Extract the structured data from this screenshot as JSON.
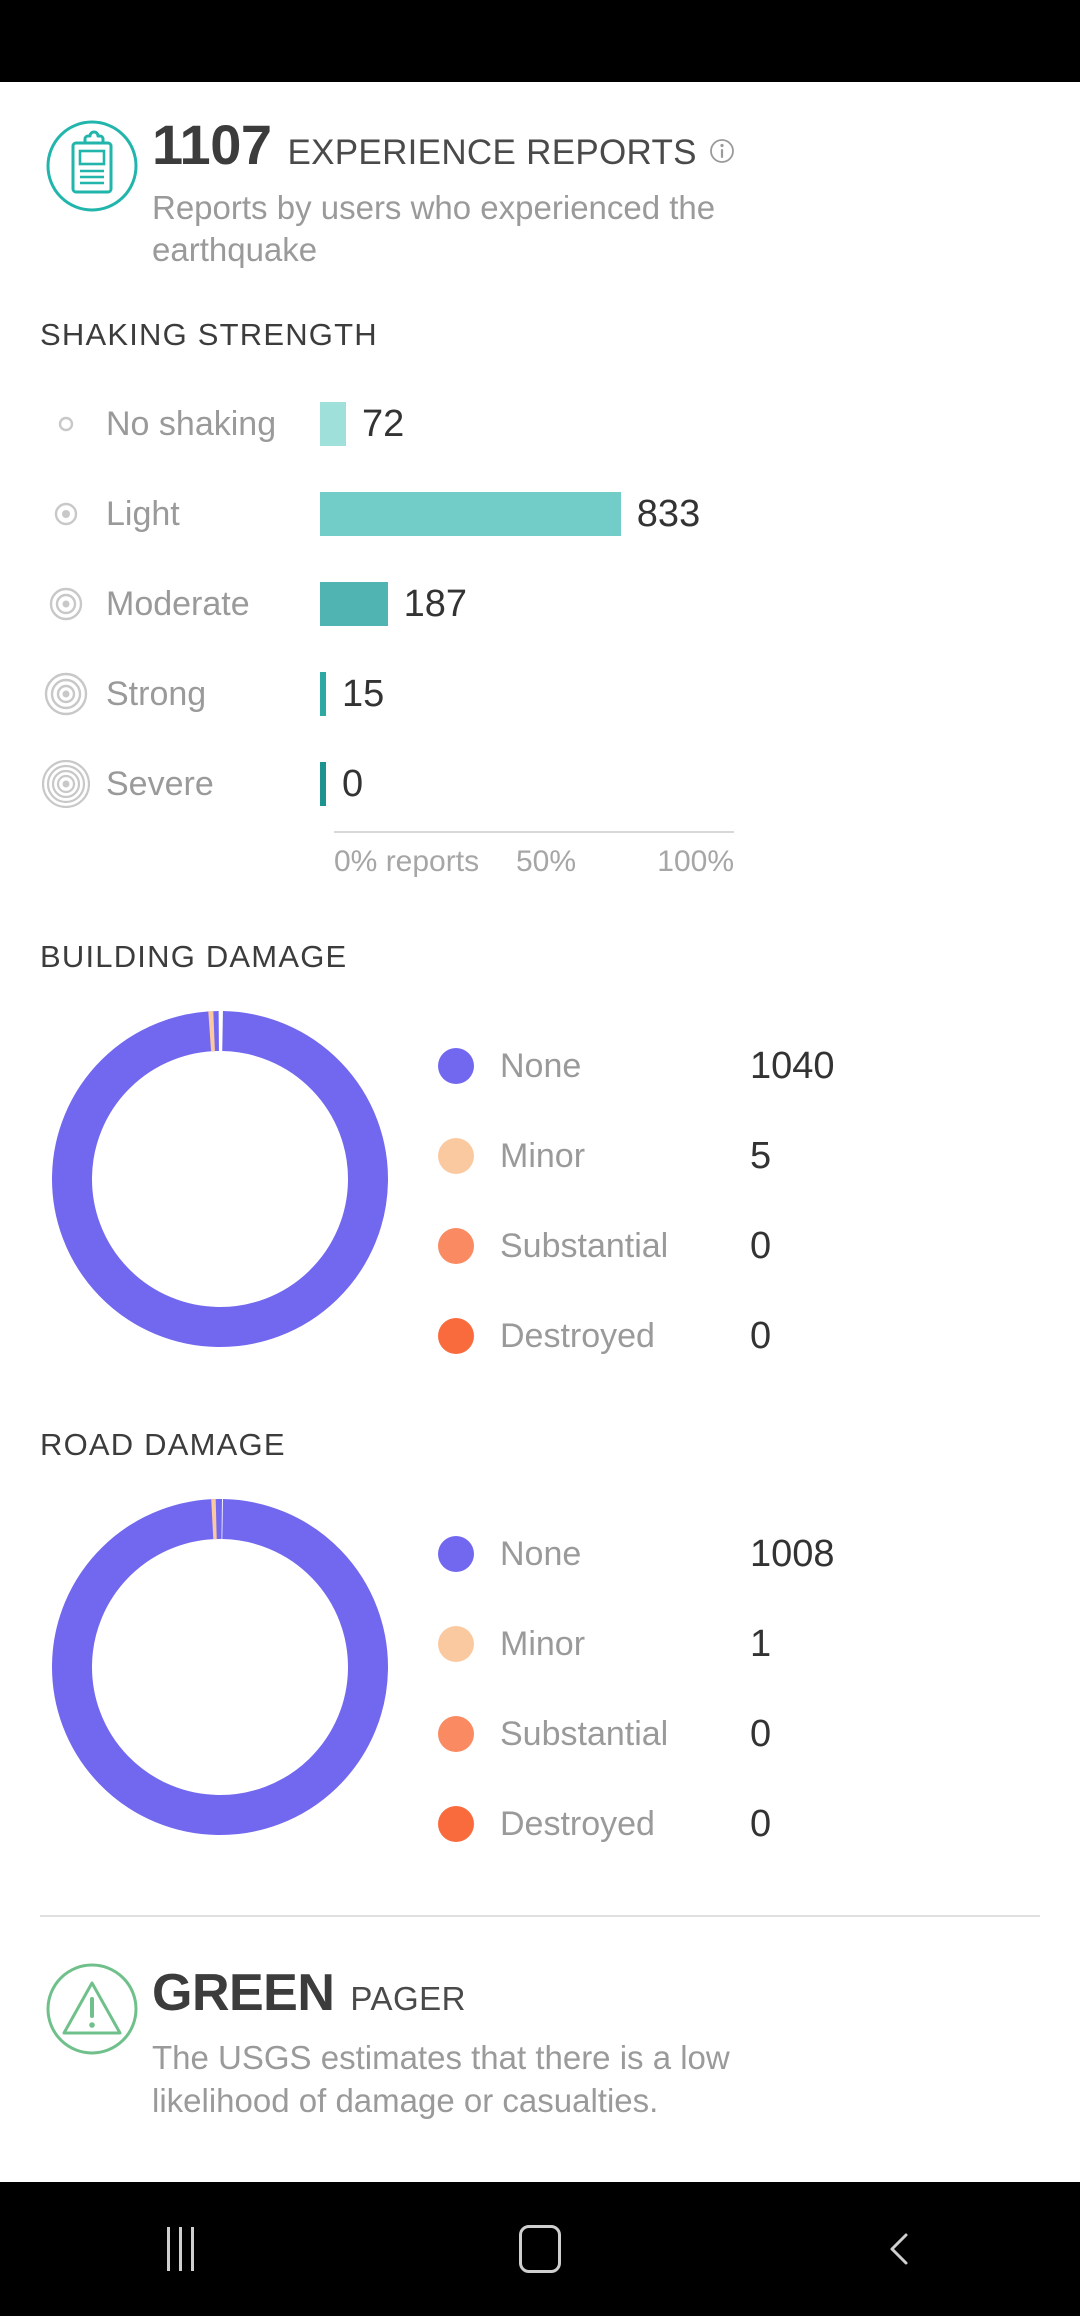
{
  "status_bar": {
    "visible": true
  },
  "header": {
    "icon": "clipboard-report-icon",
    "count": "1107",
    "label": "EXPERIENCE REPORTS",
    "info_icon": "info-circle-icon",
    "description": "Reports by users who experienced the earthquake"
  },
  "shaking": {
    "title": "SHAKING STRENGTH",
    "axis": {
      "start": "0% reports",
      "mid": "50%",
      "end": "100%"
    },
    "rows": [
      {
        "icon": "rings-1-icon",
        "label": "No shaking",
        "value": "72",
        "pct": 6.5,
        "color": "#9fe0da"
      },
      {
        "icon": "rings-2-icon",
        "label": "Light",
        "value": "833",
        "pct": 75.2,
        "color": "#72cdc9"
      },
      {
        "icon": "rings-3-icon",
        "label": "Moderate",
        "value": "187",
        "pct": 16.9,
        "color": "#50b5b2"
      },
      {
        "icon": "rings-4-icon",
        "label": "Strong",
        "value": "15",
        "pct": 1.4,
        "color": "#2da8a2"
      },
      {
        "icon": "rings-5-icon",
        "label": "Severe",
        "value": "0",
        "pct": 0.0,
        "color": "#1d938f"
      }
    ]
  },
  "building_damage": {
    "title": "BUILDING DAMAGE",
    "legend": [
      {
        "label": "None",
        "value": "1040",
        "color": "#7268f0"
      },
      {
        "label": "Minor",
        "value": "5",
        "color": "#fbc9a0"
      },
      {
        "label": "Substantial",
        "value": "0",
        "color": "#f98a62"
      },
      {
        "label": "Destroyed",
        "value": "0",
        "color": "#f96a3c"
      }
    ]
  },
  "road_damage": {
    "title": "ROAD DAMAGE",
    "legend": [
      {
        "label": "None",
        "value": "1008",
        "color": "#7268f0"
      },
      {
        "label": "Minor",
        "value": "1",
        "color": "#fbc9a0"
      },
      {
        "label": "Substantial",
        "value": "0",
        "color": "#f98a62"
      },
      {
        "label": "Destroyed",
        "value": "0",
        "color": "#f96a3c"
      }
    ]
  },
  "pager": {
    "icon": "warning-triangle-icon",
    "level": "GREEN",
    "word": "PAGER",
    "description": "The USGS estimates that there is a low likelihood of damage or casualties.",
    "color": "#6fc08a"
  },
  "nav_bar": {
    "recents": "recents-icon",
    "home": "home-icon",
    "back": "back-icon"
  },
  "chart_data": [
    {
      "type": "bar",
      "title": "SHAKING STRENGTH",
      "orientation": "horizontal",
      "categories": [
        "No shaking",
        "Light",
        "Moderate",
        "Strong",
        "Severe"
      ],
      "values": [
        72,
        833,
        187,
        15,
        0
      ],
      "percentages": [
        6.5,
        75.2,
        16.9,
        1.4,
        0.0
      ],
      "colors": [
        "#9fe0da",
        "#72cdc9",
        "#50b5b2",
        "#2da8a2",
        "#1d938f"
      ],
      "xlabel": "% reports",
      "ylabel": "",
      "xticks": [
        "0% reports",
        "50%",
        "100%"
      ],
      "xlim": [
        0,
        100
      ],
      "grid": false,
      "legend": "none"
    },
    {
      "type": "pie",
      "title": "BUILDING DAMAGE",
      "donut": true,
      "categories": [
        "None",
        "Minor",
        "Substantial",
        "Destroyed"
      ],
      "values": [
        1040,
        5,
        0,
        0
      ],
      "colors": [
        "#7268f0",
        "#fbc9a0",
        "#f98a62",
        "#f96a3c"
      ],
      "legend": "right"
    },
    {
      "type": "pie",
      "title": "ROAD DAMAGE",
      "donut": true,
      "categories": [
        "None",
        "Minor",
        "Substantial",
        "Destroyed"
      ],
      "values": [
        1008,
        1,
        0,
        0
      ],
      "colors": [
        "#7268f0",
        "#fbc9a0",
        "#f98a62",
        "#f96a3c"
      ],
      "legend": "right"
    }
  ]
}
